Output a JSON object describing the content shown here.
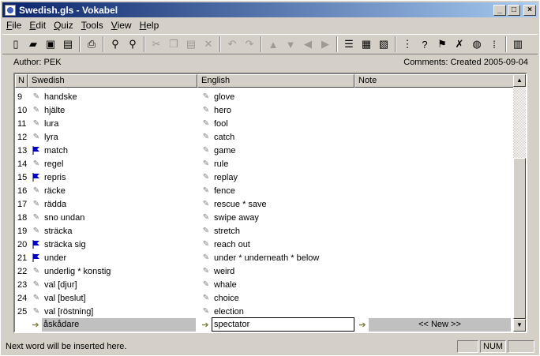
{
  "window": {
    "title": "Swedish.gls - Vokabel"
  },
  "menu": [
    {
      "underline": "F",
      "rest": "ile"
    },
    {
      "underline": "E",
      "rest": "dit"
    },
    {
      "underline": "Q",
      "rest": "uiz"
    },
    {
      "underline": "T",
      "rest": "ools"
    },
    {
      "underline": "V",
      "rest": "iew"
    },
    {
      "underline": "H",
      "rest": "elp"
    }
  ],
  "info": {
    "author": "Author: PEK",
    "comments": "Comments: Created 2005-09-04"
  },
  "grid": {
    "headers": {
      "n": "N",
      "swedish": "Swedish",
      "english": "English",
      "note": "Note"
    },
    "rows": [
      {
        "n": "9",
        "swedish": "handske",
        "english": "glove",
        "flag": false
      },
      {
        "n": "10",
        "swedish": "hjälte",
        "english": "hero",
        "flag": false
      },
      {
        "n": "11",
        "swedish": "lura",
        "english": "fool",
        "flag": false
      },
      {
        "n": "12",
        "swedish": "lyra",
        "english": "catch",
        "flag": false
      },
      {
        "n": "13",
        "swedish": "match",
        "english": "game",
        "flag": true
      },
      {
        "n": "14",
        "swedish": "regel",
        "english": "rule",
        "flag": false
      },
      {
        "n": "15",
        "swedish": "repris",
        "english": "replay",
        "flag": true
      },
      {
        "n": "16",
        "swedish": "räcke",
        "english": "fence",
        "flag": false
      },
      {
        "n": "17",
        "swedish": "rädda",
        "english": "rescue * save",
        "flag": false
      },
      {
        "n": "18",
        "swedish": "sno undan",
        "english": "swipe away",
        "flag": false
      },
      {
        "n": "19",
        "swedish": "sträcka",
        "english": "stretch",
        "flag": false
      },
      {
        "n": "20",
        "swedish": "sträcka sig",
        "english": "reach out",
        "flag": true
      },
      {
        "n": "21",
        "swedish": "under",
        "english": "under * underneath * below",
        "flag": true
      },
      {
        "n": "22",
        "swedish": "underlig * konstig",
        "english": "weird",
        "flag": false
      },
      {
        "n": "23",
        "swedish": "val [djur]",
        "english": "whale",
        "flag": false
      },
      {
        "n": "24",
        "swedish": "val [beslut]",
        "english": "choice",
        "flag": false
      },
      {
        "n": "25",
        "swedish": "val [röstning]",
        "english": "election",
        "flag": false
      }
    ],
    "new_row": {
      "swedish": "åskådare",
      "english": "spectator",
      "note": "<< New >>"
    }
  },
  "status": {
    "message": "Next word will be inserted here.",
    "panel_num": "NUM"
  },
  "colors": {
    "title_start": "#0a246a",
    "title_end": "#a6caf0",
    "flag": "#0000c0"
  }
}
